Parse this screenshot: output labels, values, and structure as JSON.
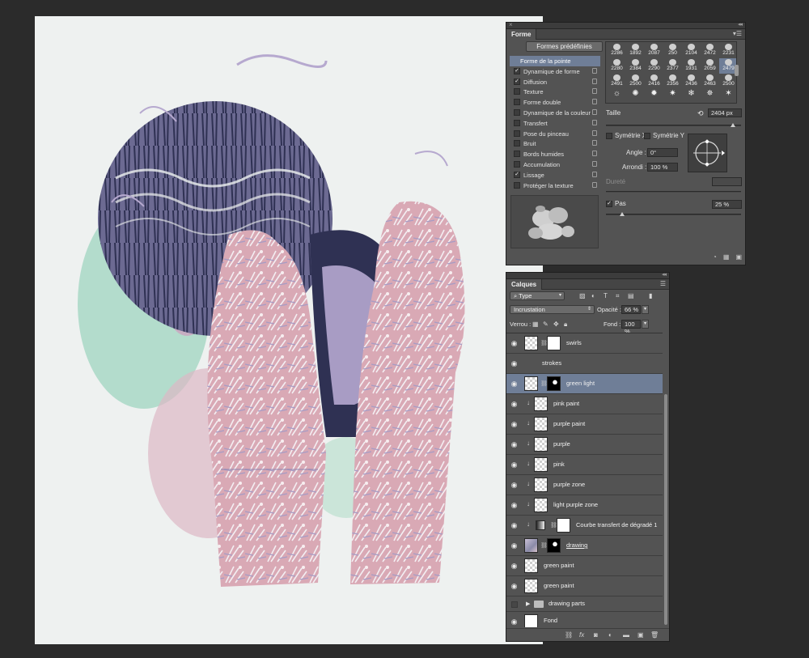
{
  "brush_panel": {
    "tab": "Forme",
    "presets_button": "Formes prédéfinies",
    "header_item": "Forme de la pointe",
    "items": [
      {
        "label": "Dynamique de forme",
        "checked": true
      },
      {
        "label": "Diffusion",
        "checked": true
      },
      {
        "label": "Texture",
        "checked": false
      },
      {
        "label": "Forme double",
        "checked": false
      },
      {
        "label": "Dynamique de la couleur",
        "checked": false
      },
      {
        "label": "Transfert",
        "checked": false
      },
      {
        "label": "Pose du pinceau",
        "checked": false
      },
      {
        "label": "Bruit",
        "checked": false
      },
      {
        "label": "Bords humides",
        "checked": false
      },
      {
        "label": "Accumulation",
        "checked": false
      },
      {
        "label": "Lissage",
        "checked": true
      },
      {
        "label": "Protéger la texture",
        "checked": false
      }
    ],
    "brush_sizes": [
      "2286",
      "1892",
      "2087",
      "250",
      "2104",
      "2472",
      "2231",
      "2280",
      "2384",
      "2290",
      "2377",
      "1931",
      "2059",
      "2479",
      "2491",
      "2500",
      "2416",
      "2356",
      "2436",
      "2463",
      "2500"
    ],
    "selected_brush": "2479",
    "size_label": "Taille",
    "size_value": "2404 px",
    "symmetry_x": "Symétrie X",
    "symmetry_y": "Symétrie Y",
    "angle_label": "Angle :",
    "angle_value": "0°",
    "roundness_label": "Arrondi :",
    "roundness_value": "100 %",
    "hardness_label": "Dureté",
    "spacing_label": "Pas",
    "spacing_checked": true,
    "spacing_value": "25 %"
  },
  "layers_panel": {
    "tab": "Calques",
    "filter_type": "Type",
    "blend_mode": "Incrustation",
    "opacity_label": "Opacité :",
    "opacity_value": "66 %",
    "lock_label": "Verrou :",
    "fill_label": "Fond :",
    "fill_value": "100 %",
    "layers": [
      {
        "name": "swirls",
        "thumb": "transparent",
        "mask": "white",
        "clipped": false,
        "visible": true
      },
      {
        "name": "strokes",
        "thumb": "none",
        "mask": "none",
        "clipped": false,
        "visible": true
      },
      {
        "name": "green light",
        "thumb": "transparent",
        "mask": "black",
        "clipped": false,
        "visible": true,
        "selected": true
      },
      {
        "name": "pink paint",
        "thumb": "transparent",
        "mask": "none",
        "clipped": true,
        "visible": true
      },
      {
        "name": "purple paint",
        "thumb": "transparent",
        "mask": "none",
        "clipped": true,
        "visible": true
      },
      {
        "name": "purple",
        "thumb": "transparent",
        "mask": "none",
        "clipped": true,
        "visible": true
      },
      {
        "name": "pink",
        "thumb": "transparent",
        "mask": "none",
        "clipped": true,
        "visible": true
      },
      {
        "name": "purple zone",
        "thumb": "transparent",
        "mask": "none",
        "clipped": true,
        "visible": true
      },
      {
        "name": "light purple zone",
        "thumb": "transparent",
        "mask": "none",
        "clipped": true,
        "visible": true
      },
      {
        "name": "Courbe transfert de dégradé 1",
        "thumb": "adjustment",
        "mask": "white",
        "clipped": true,
        "visible": true
      },
      {
        "name": "drawing",
        "thumb": "image",
        "mask": "black",
        "clipped": false,
        "visible": true,
        "underlined": true
      },
      {
        "name": "green paint",
        "thumb": "transparent",
        "mask": "none",
        "clipped": false,
        "visible": true
      },
      {
        "name": "green paint",
        "thumb": "transparent",
        "mask": "none",
        "clipped": false,
        "visible": true
      },
      {
        "name": "drawing parts",
        "thumb": "folder",
        "mask": "none",
        "clipped": false,
        "visible": false,
        "group": true
      },
      {
        "name": "Fond",
        "thumb": "white",
        "mask": "none",
        "clipped": false,
        "visible": true,
        "last": true
      }
    ]
  },
  "colors": {
    "app_bg": "#2b2b2b",
    "panel_bg": "#535353",
    "selection": "#6f7e97",
    "canvas_bg": "#eef1f0",
    "mint": "#9fd4c0",
    "purple": "#a89cc4",
    "pink": "#d9a9b5",
    "navy": "#2a2d4d"
  }
}
